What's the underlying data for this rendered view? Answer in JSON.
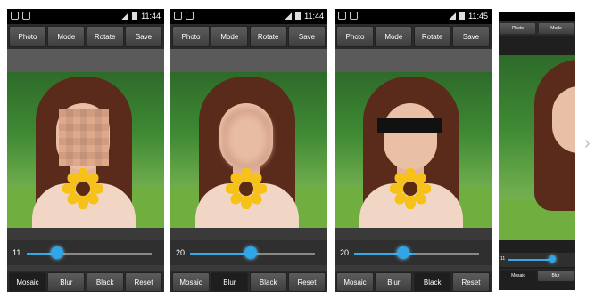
{
  "screens": [
    {
      "time": "11:44",
      "toolbar": [
        "Photo",
        "Mode",
        "Rotate",
        "Save"
      ],
      "slider_value": "11",
      "slider_fraction": 0.3,
      "bottom": [
        "Mosaic",
        "Blur",
        "Black",
        "Reset"
      ],
      "active": "Mosaic"
    },
    {
      "time": "11:44",
      "toolbar": [
        "Photo",
        "Mode",
        "Rotate",
        "Save"
      ],
      "slider_value": "20",
      "slider_fraction": 0.55,
      "bottom": [
        "Mosaic",
        "Blur",
        "Black",
        "Reset"
      ],
      "active": "Blur"
    },
    {
      "time": "11:45",
      "toolbar": [
        "Photo",
        "Mode",
        "Rotate",
        "Save"
      ],
      "slider_value": "20",
      "slider_fraction": 0.55,
      "bottom": [
        "Mosaic",
        "Blur",
        "Black",
        "Reset"
      ],
      "active": "Black"
    },
    {
      "toolbar": [
        "Photo",
        "Mode"
      ],
      "slider_value": "11",
      "bottom": [
        "Mosaic",
        "Blur"
      ]
    }
  ],
  "next_arrow": "›"
}
